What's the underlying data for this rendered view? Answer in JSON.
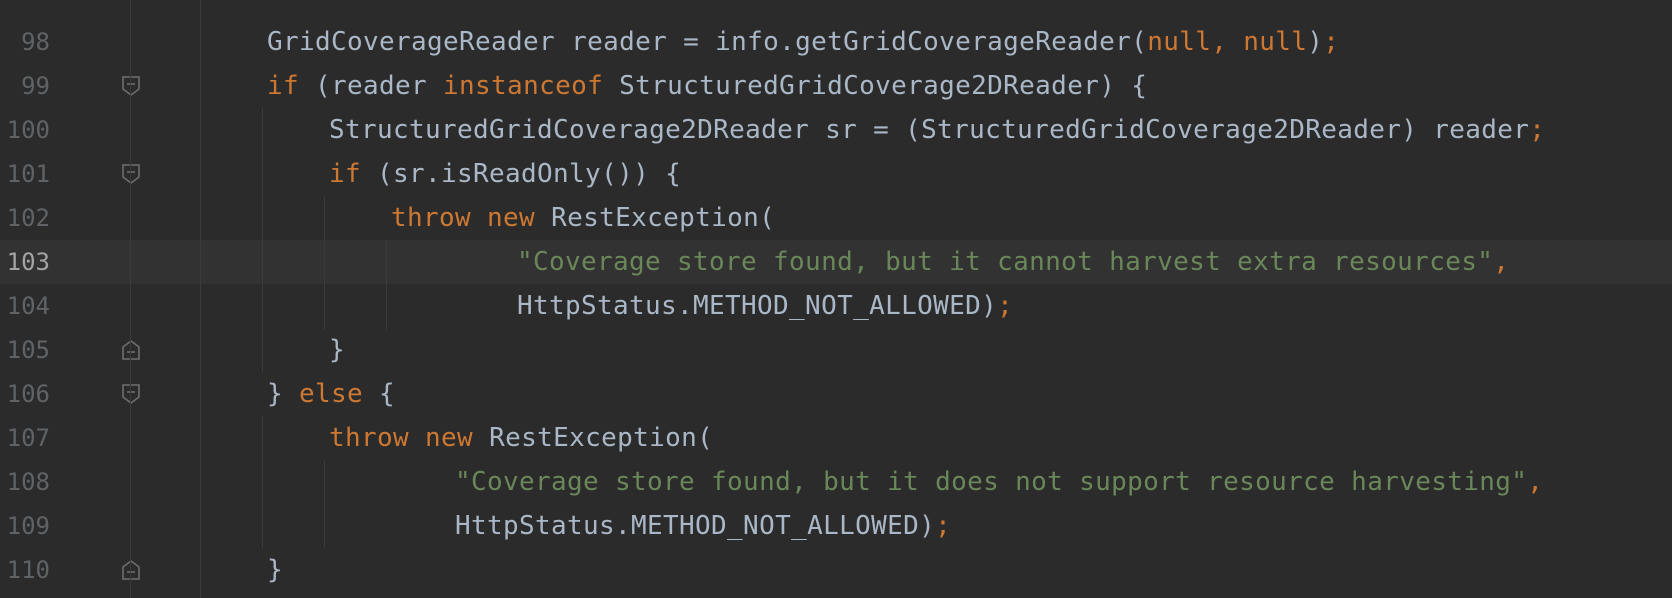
{
  "editor": {
    "theme_colors": {
      "background": "#2b2b2b",
      "keyword": "#cc7832",
      "string": "#6a8759",
      "plain": "#a9b7c6",
      "line_number": "#606366",
      "current_line": "#323232"
    },
    "lines": [
      {
        "num": "98",
        "tokens": [
          {
            "t": "GridCoverageReader reader = info.getGridCoverageReader(",
            "c": "pl"
          },
          {
            "t": "null",
            "c": "kw"
          },
          {
            "t": ", ",
            "c": "kw"
          },
          {
            "t": "null",
            "c": "kw"
          },
          {
            "t": ")",
            "c": "pl"
          },
          {
            "t": ";",
            "c": "kw"
          }
        ]
      },
      {
        "num": "99",
        "tokens": [
          {
            "t": "if",
            "c": "kw"
          },
          {
            "t": " (reader ",
            "c": "pl"
          },
          {
            "t": "instanceof",
            "c": "kw"
          },
          {
            "t": " StructuredGridCoverage2DReader) {",
            "c": "pl"
          }
        ]
      },
      {
        "num": "100",
        "tokens": [
          {
            "t": "StructuredGridCoverage2DReader sr = (StructuredGridCoverage2DReader) reader",
            "c": "pl"
          },
          {
            "t": ";",
            "c": "kw"
          }
        ]
      },
      {
        "num": "101",
        "tokens": [
          {
            "t": "if",
            "c": "kw"
          },
          {
            "t": " (sr.isReadOnly()) {",
            "c": "pl"
          }
        ]
      },
      {
        "num": "102",
        "tokens": [
          {
            "t": "throw",
            "c": "kw"
          },
          {
            "t": " ",
            "c": "pl"
          },
          {
            "t": "new",
            "c": "kw"
          },
          {
            "t": " RestException(",
            "c": "pl"
          }
        ]
      },
      {
        "num": "103",
        "tokens": [
          {
            "t": "\"Coverage store found, but it cannot harvest extra resources\"",
            "c": "str"
          },
          {
            "t": ",",
            "c": "kw"
          }
        ]
      },
      {
        "num": "104",
        "tokens": [
          {
            "t": "HttpStatus.METHOD_NOT_ALLOWED)",
            "c": "pl"
          },
          {
            "t": ";",
            "c": "kw"
          }
        ]
      },
      {
        "num": "105",
        "tokens": [
          {
            "t": "}",
            "c": "pl"
          }
        ]
      },
      {
        "num": "106",
        "tokens": [
          {
            "t": "} ",
            "c": "pl"
          },
          {
            "t": "else",
            "c": "kw"
          },
          {
            "t": " {",
            "c": "pl"
          }
        ]
      },
      {
        "num": "107",
        "tokens": [
          {
            "t": "throw",
            "c": "kw"
          },
          {
            "t": " ",
            "c": "pl"
          },
          {
            "t": "new",
            "c": "kw"
          },
          {
            "t": " RestException(",
            "c": "pl"
          }
        ]
      },
      {
        "num": "108",
        "tokens": [
          {
            "t": "\"Coverage store found, but it does not support resource harvesting\"",
            "c": "str"
          },
          {
            "t": ",",
            "c": "kw"
          }
        ]
      },
      {
        "num": "109",
        "tokens": [
          {
            "t": "HttpStatus.METHOD_NOT_ALLOWED)",
            "c": "pl"
          },
          {
            "t": ";",
            "c": "kw"
          }
        ]
      },
      {
        "num": "110",
        "tokens": [
          {
            "t": "}",
            "c": "pl"
          }
        ]
      }
    ]
  }
}
